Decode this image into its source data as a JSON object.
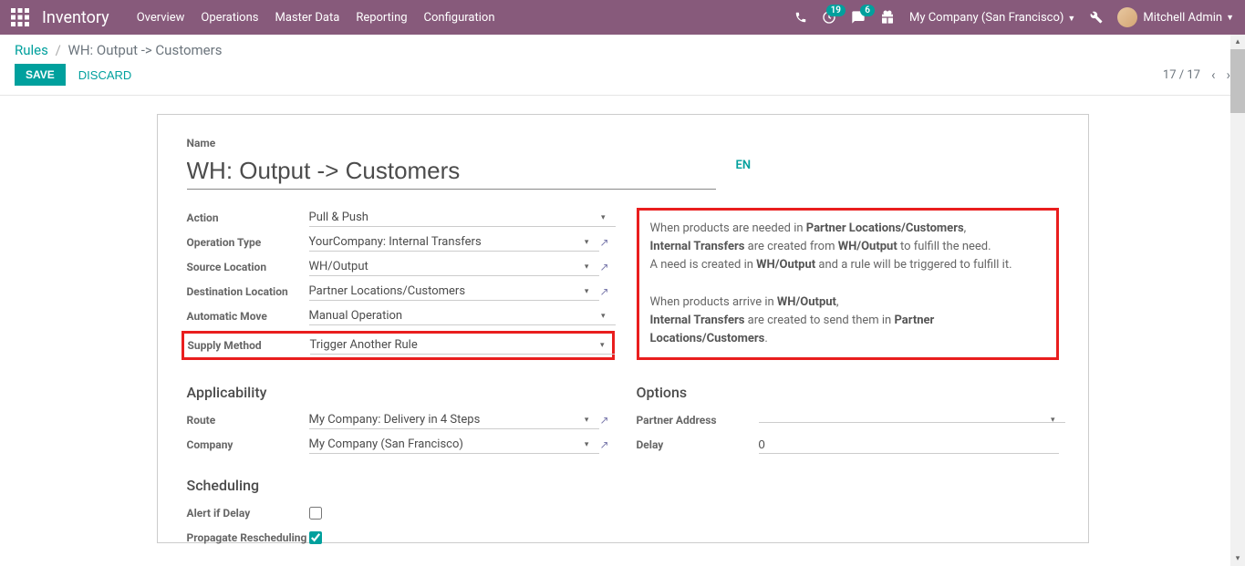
{
  "nav": {
    "brand": "Inventory",
    "menu": [
      "Overview",
      "Operations",
      "Master Data",
      "Reporting",
      "Configuration"
    ],
    "badge_activity": "19",
    "badge_chat": "6",
    "company": "My Company (San Francisco)",
    "user": "Mitchell Admin"
  },
  "breadcrumb": {
    "root": "Rules",
    "current": "WH: Output -> Customers"
  },
  "buttons": {
    "save": "SAVE",
    "discard": "DISCARD"
  },
  "pager": {
    "pos": "17 / 17"
  },
  "form": {
    "name_label": "Name",
    "name_value": "WH: Output -> Customers",
    "lang": "EN",
    "labels": {
      "action": "Action",
      "operation_type": "Operation Type",
      "source_location": "Source Location",
      "destination_location": "Destination Location",
      "automatic_move": "Automatic Move",
      "supply_method": "Supply Method",
      "route": "Route",
      "company": "Company",
      "partner_address": "Partner Address",
      "delay": "Delay",
      "alert_delay": "Alert if Delay",
      "propagate": "Propagate Rescheduling"
    },
    "values": {
      "action": "Pull & Push",
      "operation_type": "YourCompany: Internal Transfers",
      "source_location": "WH/Output",
      "destination_location": "Partner Locations/Customers",
      "automatic_move": "Manual Operation",
      "supply_method": "Trigger Another Rule",
      "route": "My Company: Delivery in 4 Steps",
      "company": "My Company (San Francisco)",
      "partner_address": "",
      "delay": "0"
    },
    "sections": {
      "applicability": "Applicability",
      "options": "Options",
      "scheduling": "Scheduling"
    },
    "desc": {
      "l1a": "When products are needed in ",
      "l1b": "Partner Locations/Customers",
      "l1c": ",",
      "l2a": "Internal Transfers",
      "l2b": " are created from ",
      "l2c": "WH/Output",
      "l2d": " to fulfill the need.",
      "l3a": "A need is created in ",
      "l3b": "WH/Output",
      "l3c": " and a rule will be triggered to fulfill it.",
      "l4a": "When products arrive in ",
      "l4b": "WH/Output",
      "l4c": ",",
      "l5a": "Internal Transfers",
      "l5b": " are created to send them in ",
      "l5c": "Partner Locations/Customers",
      "l5d": "."
    }
  }
}
